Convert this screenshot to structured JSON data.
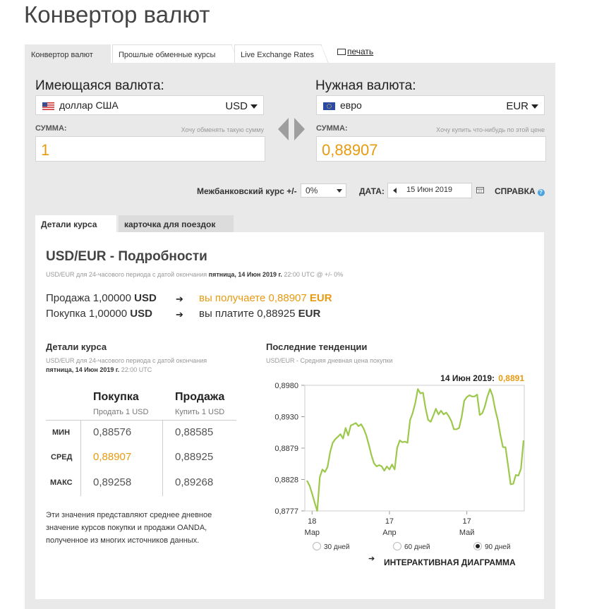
{
  "title": "Конвертор валют",
  "tabs": [
    "Конвертор валют",
    "Прошлые обменные курсы",
    "Live Exchange Rates"
  ],
  "print_label": "печать",
  "have": {
    "label": "Имеющаяся валюта:",
    "currency_name": "доллар США",
    "currency_code": "USD",
    "amount_label": "СУММА:",
    "amount_hint": "Хочу обменять такую сумму",
    "amount": "1"
  },
  "want": {
    "label": "Нужная валюта:",
    "currency_name": "евро",
    "currency_code": "EUR",
    "amount_label": "СУММА:",
    "amount_hint": "Хочу купить что-нибудь по этой цене",
    "amount": "0,88907"
  },
  "interbank": {
    "label": "Межбанковский курс +/-",
    "value": "0%"
  },
  "date": {
    "label": "ДАТА:",
    "value": "15 Июн 2019"
  },
  "help_label": "СПРАВКА",
  "inner_tabs": [
    "Детали курса",
    "карточка для поездок"
  ],
  "details": {
    "heading": "USD/EUR - Подробности",
    "period_prefix": "USD/EUR для 24-часового периода с датой окончания",
    "period_date": "пятница, 14 Июн 2019 г.",
    "period_suffix": "22:00 UTC @ +/- 0%",
    "sell_line": {
      "prefix": "Продажа 1,00000",
      "cur": "USD",
      "result_prefix": "вы получаете 0,88907",
      "result_cur": "EUR"
    },
    "buy_line": {
      "prefix": "Покупка 1,00000",
      "cur": "USD",
      "result_prefix": "вы платите 0,88925",
      "result_cur": "EUR"
    }
  },
  "rate_details": {
    "heading": "Детали курса",
    "period_prefix": "USD/EUR для 24-часового периода с датой окончания",
    "period_date": "пятница, 14 Июн 2019 г.",
    "period_suffix": "22:00 UTC",
    "col_buy": "Покупка",
    "col_buy_sub": "Продать 1 USD",
    "col_sell": "Продажа",
    "col_sell_sub": "Купить 1 USD",
    "rows": [
      {
        "label": "МИН",
        "buy": "0,88576",
        "sell": "0,88585"
      },
      {
        "label": "СРЕД",
        "buy": "0,88907",
        "sell": "0,88925"
      },
      {
        "label": "МАКС",
        "buy": "0,89258",
        "sell": "0,89268"
      }
    ],
    "note": "Эти значения представляют среднее дневное значение курсов покупки и продажи OANDA, полученное из многих источников данных."
  },
  "trend": {
    "heading": "Последние тенденции",
    "sub": "USD/EUR - Средняя дневная цена покупки",
    "highlight_label": "14 Июн 2019:",
    "highlight_value": "0,8891",
    "periods": [
      "30 дней",
      "60 дней",
      "90 дней"
    ],
    "interactive_label": "ИНТЕРАКТИВНАЯ ДИАГРАММА"
  },
  "colors": {
    "accent": "#e89a10",
    "line": "#9cc84b",
    "panel": "#e9e9e9"
  },
  "chart_data": {
    "type": "line",
    "yticks": [
      "0,8980",
      "0,8930",
      "0,8879",
      "0,8828",
      "0,8777"
    ],
    "ylim": [
      0.8777,
      0.898
    ],
    "xticks": [
      {
        "day": "18",
        "month": "Мар",
        "i": 2
      },
      {
        "day": "17",
        "month": "Апр",
        "i": 32
      },
      {
        "day": "17",
        "month": "Май",
        "i": 62
      }
    ],
    "series": [
      {
        "values": [
          0.8826,
          0.8818,
          0.8805,
          0.879,
          0.8777,
          0.8832,
          0.8844,
          0.884,
          0.8848,
          0.8872,
          0.8887,
          0.8893,
          0.8897,
          0.8901,
          0.8894,
          0.8911,
          0.8899,
          0.8915,
          0.8917,
          0.8919,
          0.8914,
          0.8917,
          0.891,
          0.8899,
          0.8884,
          0.8867,
          0.8854,
          0.8849,
          0.8851,
          0.8849,
          0.8842,
          0.8849,
          0.8844,
          0.8852,
          0.8844,
          0.8879,
          0.8891,
          0.8888,
          0.8889,
          0.8887,
          0.8924,
          0.8935,
          0.8951,
          0.8974,
          0.8967,
          0.8968,
          0.8943,
          0.8924,
          0.8921,
          0.8931,
          0.8942,
          0.8933,
          0.8939,
          0.8933,
          0.8936,
          0.893,
          0.8922,
          0.8909,
          0.8909,
          0.8911,
          0.8929,
          0.8955,
          0.8961,
          0.8964,
          0.8962,
          0.8962,
          0.8965,
          0.8932,
          0.8935,
          0.8946,
          0.8962,
          0.8974,
          0.8963,
          0.8941,
          0.8924,
          0.89,
          0.888,
          0.888,
          0.885,
          0.882,
          0.8821,
          0.8835,
          0.8834,
          0.8845,
          0.8891
        ]
      }
    ]
  }
}
